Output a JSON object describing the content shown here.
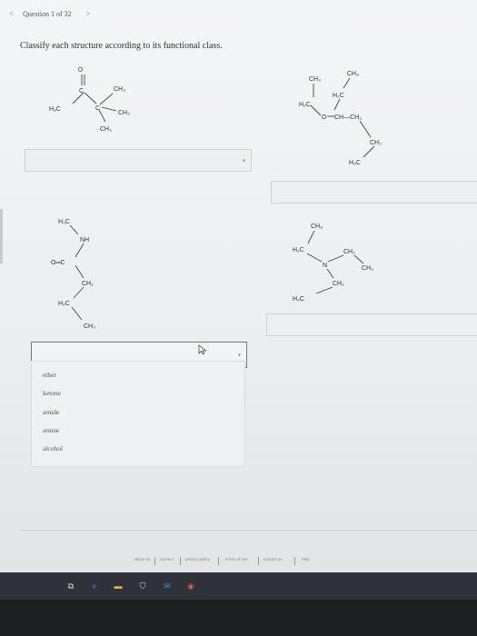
{
  "nav": {
    "prev": "<",
    "title": "Question 1 of 32",
    "next": ">"
  },
  "prompt": "Classify each structure according to its functional class.",
  "molecules": {
    "m1": {
      "o": "O",
      "c": "C",
      "h3c": "H₃C",
      "ch3a": "CH₃",
      "ch3b": "CH₃",
      "ch3c": "CH₃"
    },
    "m2": {
      "ch3a": "CH₃",
      "ch3b": "CH₃",
      "h2ca": "H₂C",
      "h2cb": "H₂C",
      "o": "O",
      "chch2": "CH—CH₂",
      "ch2": "CH₂",
      "h3c": "H₃C"
    },
    "m3": {
      "h3c": "H₃C",
      "nh": "NH",
      "oc": "O═C",
      "ch2": "CH₂",
      "h2c": "H₂C",
      "ch3": "CH₃"
    },
    "m4": {
      "ch3": "CH₃",
      "h2c": "H₂C",
      "n": "N",
      "ch2a": "CH₂",
      "ch3b": "CH₃",
      "ch2b": "CH₂",
      "h3c": "H₃C"
    }
  },
  "dropdown": {
    "options": [
      "ether",
      "ketone",
      "amide",
      "amine",
      "alcohol"
    ]
  },
  "footer": [
    "about us",
    "careers",
    "privacy policy",
    "terms of use",
    "contact us",
    "help"
  ]
}
